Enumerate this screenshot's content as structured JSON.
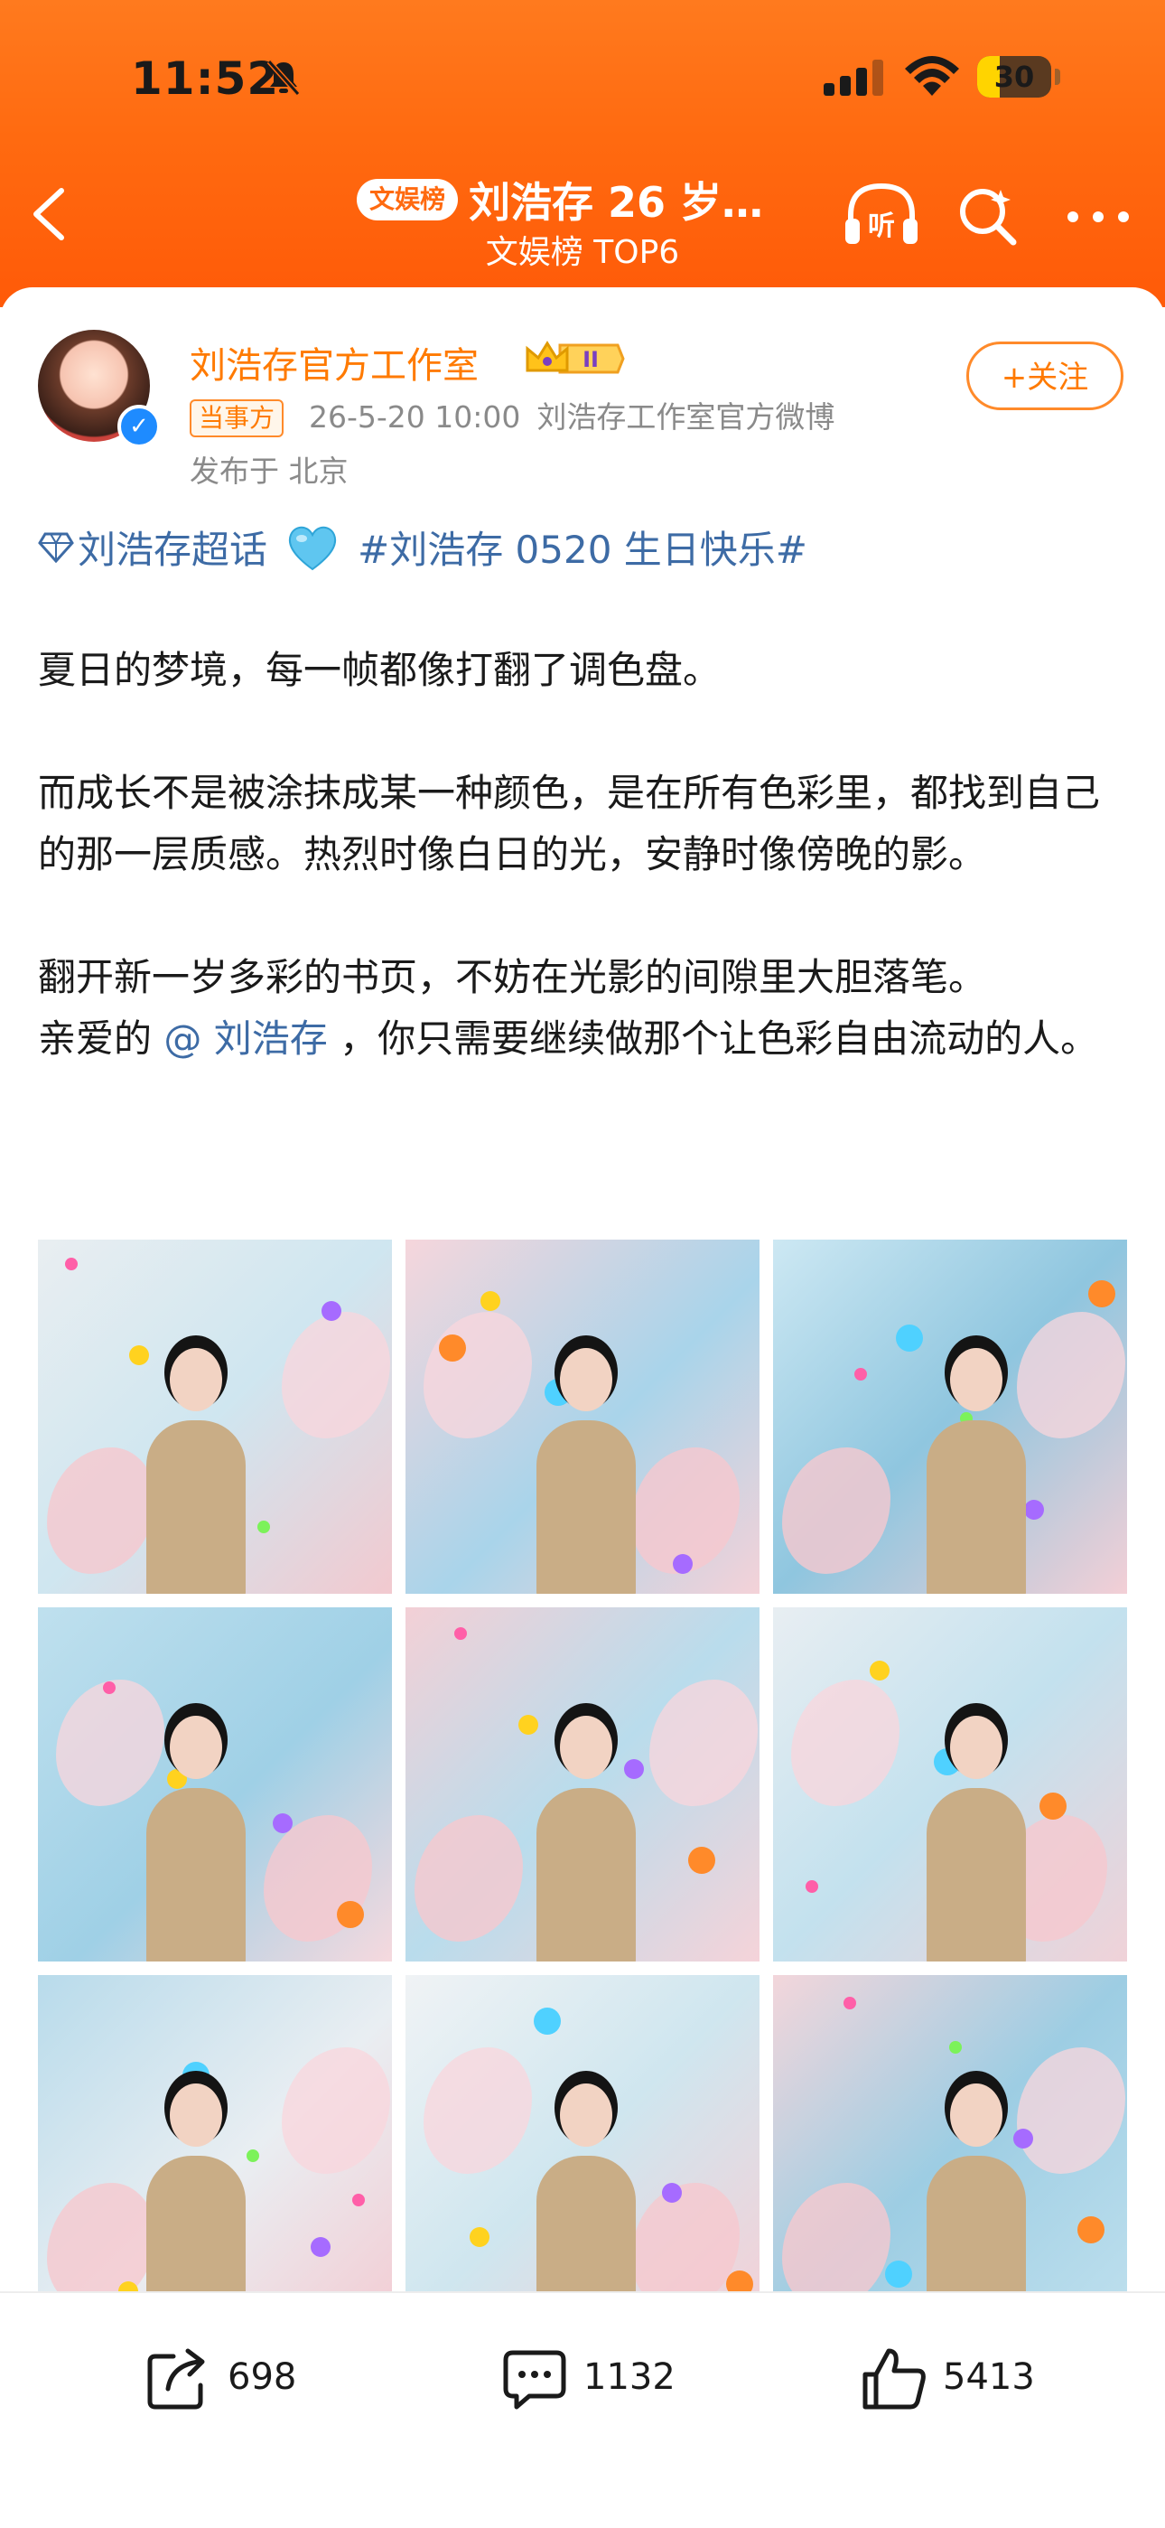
{
  "status_bar": {
    "time": "11:52",
    "battery": "30"
  },
  "header": {
    "tag": "文娱榜",
    "title": "刘浩存 26 岁…",
    "subtitle": "文娱榜 TOP6"
  },
  "post": {
    "author": "刘浩存官方工作室",
    "role_tag": "当事方",
    "timestamp": "26-5-20 10:00",
    "source": "刘浩存工作室官方微博",
    "location": "发布于 北京",
    "follow_label": "+关注",
    "topic_super": "刘浩存超话",
    "topic_hashtag": "#刘浩存 0520 生日快乐#",
    "paragraph1": "夏日的梦境，每一帧都像打翻了调色盘。",
    "paragraph2": "而成长不是被涂抹成某一种颜色，是在所有色彩里，都找到自己的那一层质感。热烈时像白日的光，安静时像傍晚的影。",
    "paragraph3_line1": "翻开新一岁多彩的书页，不妨在光影的间隙里大胆落笔。",
    "paragraph3_prefix": "亲爱的 ",
    "mention": "@ 刘浩存",
    "paragraph3_suffix": " ，你只需要继续做那个让色彩自由流动的人。",
    "photo_count": 9
  },
  "actions": {
    "share": "698",
    "comment": "1132",
    "like": "5413"
  },
  "colors": {
    "header_orange": "#ff6a10",
    "accent_orange": "#ff7a00",
    "link_blue": "#3d6ba5"
  }
}
